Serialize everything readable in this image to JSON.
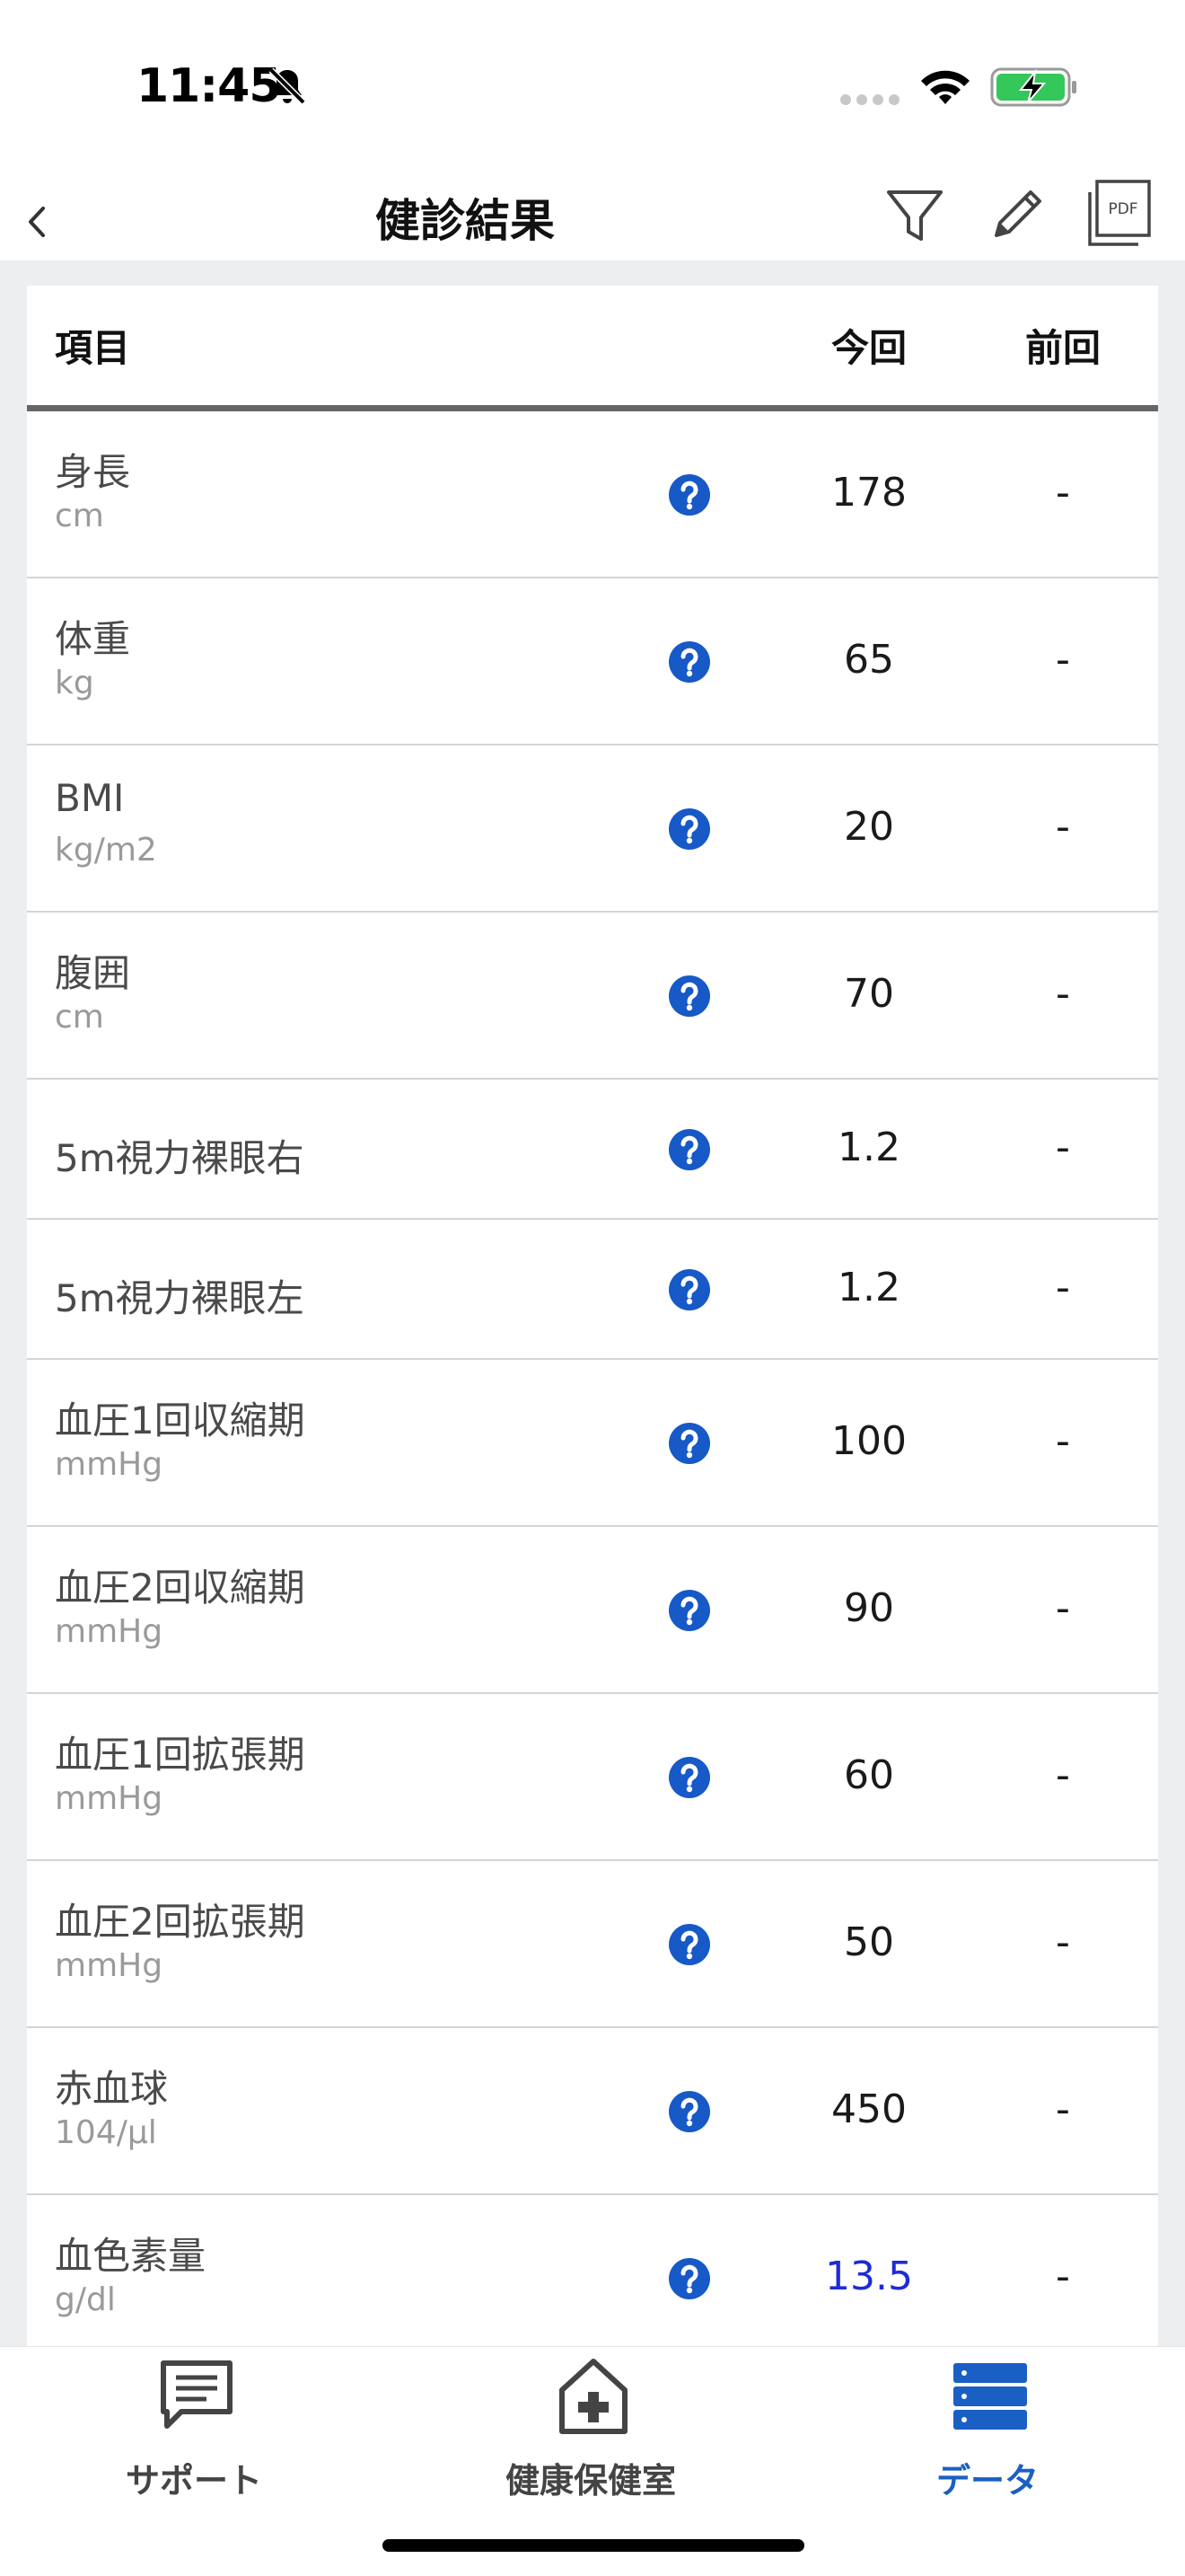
{
  "status_bar": {
    "time": "11:45",
    "icons": [
      "bell-slash-icon",
      "signal-icon",
      "wifi-icon",
      "battery-charging-icon"
    ]
  },
  "nav": {
    "title": "健診結果",
    "back_icon": "chevron-left-icon",
    "action_icons": [
      "filter-icon",
      "pencil-icon",
      "pdf-icon"
    ],
    "pdf_icon_text": "PDF"
  },
  "table": {
    "headers": {
      "item": "項目",
      "current": "今回",
      "previous": "前回"
    },
    "rows": [
      {
        "name": "身長",
        "unit": "cm",
        "current": "178",
        "previous": "-"
      },
      {
        "name": "体重",
        "unit": "kg",
        "current": "65",
        "previous": "-"
      },
      {
        "name": "BMI",
        "unit": "kg/m2",
        "current": "20",
        "previous": "-"
      },
      {
        "name": "腹囲",
        "unit": "cm",
        "current": "70",
        "previous": "-"
      },
      {
        "name": "5m視力裸眼右",
        "unit": "",
        "current": "1.2",
        "previous": "-"
      },
      {
        "name": "5m視力裸眼左",
        "unit": "",
        "current": "1.2",
        "previous": "-"
      },
      {
        "name": "血圧1回収縮期",
        "unit": "mmHg",
        "current": "100",
        "previous": "-"
      },
      {
        "name": "血圧2回収縮期",
        "unit": "mmHg",
        "current": "90",
        "previous": "-"
      },
      {
        "name": "血圧1回拡張期",
        "unit": "mmHg",
        "current": "60",
        "previous": "-"
      },
      {
        "name": "血圧2回拡張期",
        "unit": "mmHg",
        "current": "50",
        "previous": "-"
      },
      {
        "name": "赤血球",
        "unit": "104/μl",
        "current": "450",
        "previous": "-"
      },
      {
        "name": "血色素量",
        "unit": "g/dl",
        "current": "13.5",
        "previous": "-",
        "current_color": "#1f2bd6"
      }
    ]
  },
  "colors": {
    "accent": "#1a5fc4",
    "help_icon": "#1659c7",
    "highlight_value": "#1f2bd6"
  },
  "tab_bar": {
    "tabs": [
      {
        "label": "サポート",
        "icon": "chat-icon",
        "active": false
      },
      {
        "label": "健康保健室",
        "icon": "health-house-icon",
        "active": false
      },
      {
        "label": "データ",
        "icon": "database-icon",
        "active": true
      }
    ]
  }
}
